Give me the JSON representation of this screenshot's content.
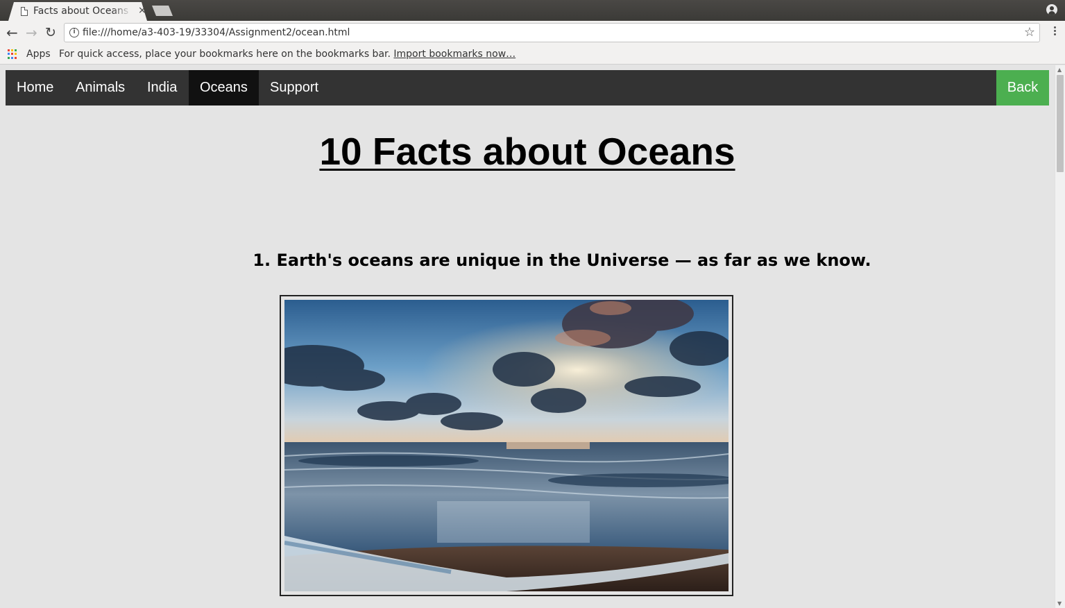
{
  "browser": {
    "tab_title": "Facts about Oceans",
    "tab_close": "×",
    "address": "file:///home/a3-403-19/33304/Assignment2/ocean.html",
    "bookmarks_apps": "Apps",
    "bookmarks_hint": "For quick access, place your bookmarks here on the bookmarks bar.",
    "bookmarks_import": "Import bookmarks now…"
  },
  "navbar": {
    "items": [
      "Home",
      "Animals",
      "India",
      "Oceans",
      "Support"
    ],
    "active": "Oceans",
    "back_label": "Back",
    "back_color": "#4caf50",
    "bar_color": "#333333"
  },
  "main": {
    "title": "10 Facts about Oceans",
    "fact_1_heading": "1. Earth's oceans are unique in the Universe — as far as we know."
  },
  "icons": {
    "back": "back-arrow-icon",
    "forward": "forward-arrow-icon",
    "reload": "reload-icon",
    "info": "info-icon",
    "bookmark": "star-icon",
    "menu": "kebab-menu-icon",
    "apps": "apps-grid-icon",
    "profile": "profile-icon"
  }
}
